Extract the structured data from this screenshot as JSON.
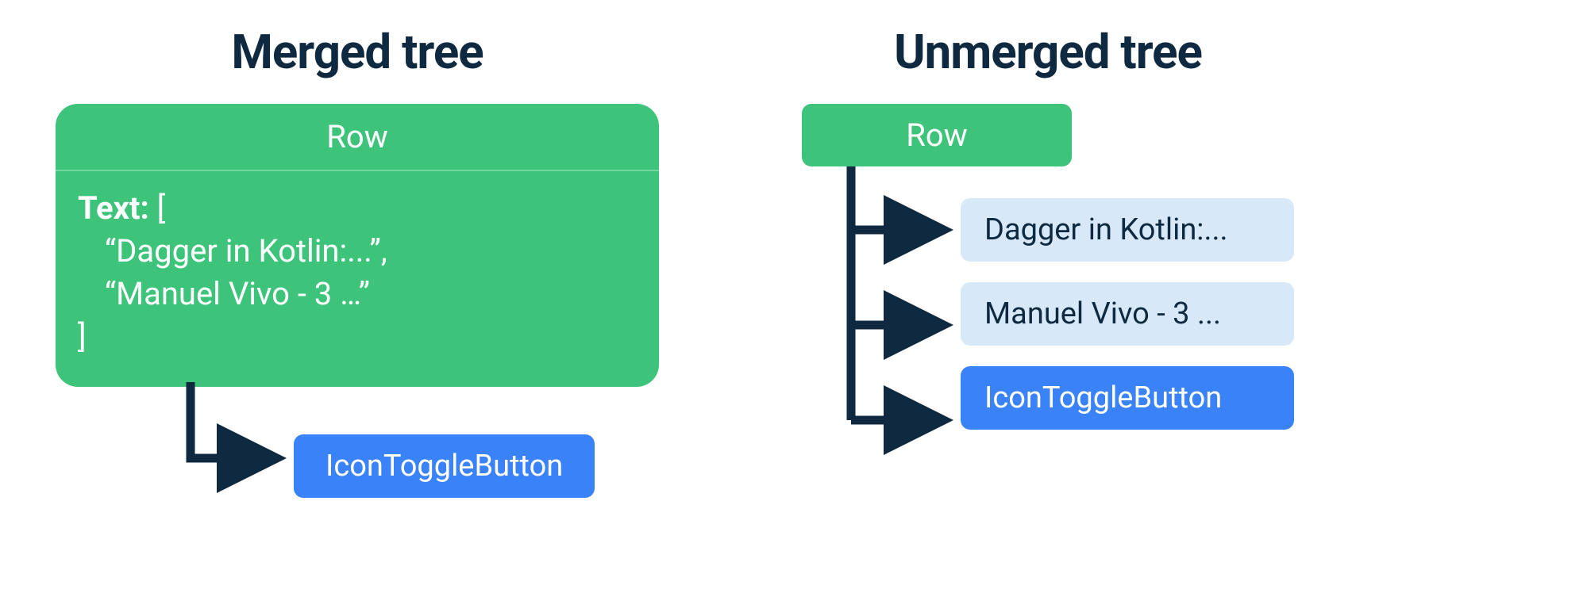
{
  "merged": {
    "title": "Merged tree",
    "row_label": "Row",
    "text_label": "Text:",
    "bracket_open": " [",
    "line1": "“Dagger in Kotlin:...”,",
    "line2": "“Manuel Vivo - 3 …”",
    "bracket_close": "]",
    "child": "IconToggleButton"
  },
  "unmerged": {
    "title": "Unmerged tree",
    "row_label": "Row",
    "leaf1": "Dagger in Kotlin:...",
    "leaf2": "Manuel Vivo - 3 ...",
    "leaf3": "IconToggleButton"
  },
  "colors": {
    "green": "#3ec47a",
    "blue": "#3a82f7",
    "lightblue": "#d7e9f8",
    "text": "#0f2a40"
  }
}
